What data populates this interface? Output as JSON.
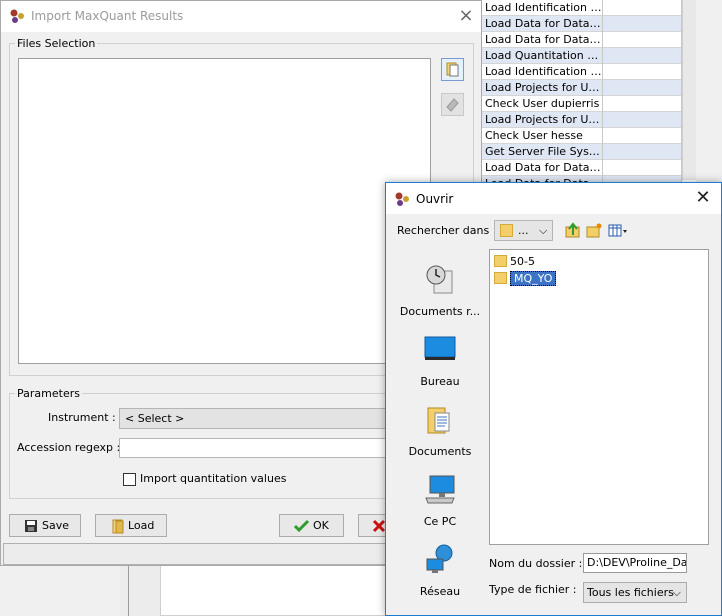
{
  "background": {
    "tasks": [
      "Load Identification Da...",
      "Load Data for Datase...",
      "Load Data for Datase...",
      "Load Quantitation Da...",
      "Load Identification Da...",
      "Load Projects for Use...",
      "Check User dupierris",
      "Load Projects for Use...",
      "Check User hesse",
      "Get Server File Syste...",
      "Load Data for Datase...",
      "Load Data for Datase..."
    ]
  },
  "main": {
    "title": "Import MaxQuant Results",
    "files_section": "Files Selection",
    "parameters_section": "Parameters",
    "instrument_label": "Instrument :",
    "instrument_value": "< Select >",
    "accession_label": "Accession regexp :",
    "accession_value": "",
    "import_quant_label": "Import quantitation values",
    "import_quant_checked": false,
    "save_label": "Save",
    "load_label": "Load",
    "ok_label": "OK"
  },
  "open": {
    "title": "Ouvrir",
    "lookin_label": "Rechercher dans :",
    "lookin_value": "...",
    "places": [
      {
        "label": "Documents r...",
        "icon": "recent-documents-icon"
      },
      {
        "label": "Bureau",
        "icon": "desktop-icon"
      },
      {
        "label": "Documents",
        "icon": "documents-icon"
      },
      {
        "label": "Ce PC",
        "icon": "computer-icon"
      },
      {
        "label": "Réseau",
        "icon": "network-icon"
      }
    ],
    "files": [
      {
        "name": "50-5",
        "selected": false
      },
      {
        "name": "MQ_YO",
        "selected": true
      }
    ],
    "folder_name_label": "Nom du dossier :",
    "folder_name_value": "D:\\DEV\\Proline_Data",
    "file_type_label": "Type de fichier :",
    "file_type_value": "Tous les fichiers"
  },
  "colors": {
    "accent": "#1e7bd2",
    "selection": "#3c73c6",
    "row_alt": "#dfe6f4",
    "ok_green": "#2e9c2e",
    "cancel_red": "#cc1111"
  }
}
